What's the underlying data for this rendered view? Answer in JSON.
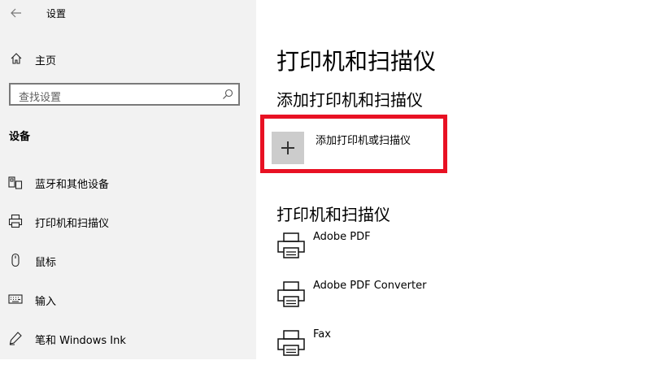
{
  "window": {
    "title": "设置"
  },
  "sidebar": {
    "home_label": "主页",
    "search_placeholder": "查找设置",
    "section_heading": "设备",
    "items": [
      {
        "label": "蓝牙和其他设备",
        "icon": "bluetooth-devices-icon"
      },
      {
        "label": "打印机和扫描仪",
        "icon": "printer-icon"
      },
      {
        "label": "鼠标",
        "icon": "mouse-icon"
      },
      {
        "label": "输入",
        "icon": "keyboard-icon"
      },
      {
        "label": "笔和 Windows Ink",
        "icon": "pen-icon"
      }
    ]
  },
  "main": {
    "page_title": "打印机和扫描仪",
    "add_section_title": "添加打印机和扫描仪",
    "add_button_label": "添加打印机或扫描仪",
    "list_title": "打印机和扫描仪",
    "printers": [
      {
        "name": "Adobe PDF"
      },
      {
        "name": "Adobe PDF Converter"
      },
      {
        "name": "Fax"
      }
    ]
  },
  "colors": {
    "sidebar_bg": "#f2f2f2",
    "highlight_border": "#e81123",
    "add_tile_bg": "#cccccc"
  }
}
